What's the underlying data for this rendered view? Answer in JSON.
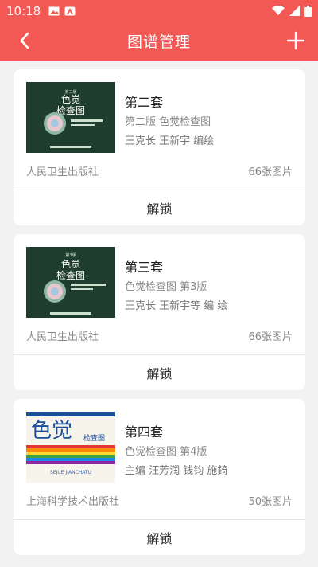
{
  "status_bar": {
    "time": "10:18"
  },
  "header": {
    "title": "图谱管理"
  },
  "books": [
    {
      "title": "第二套",
      "subtitle": "第二版 色觉检查图",
      "authors": "王克长 王新宇 编绘",
      "publisher": "人民卫生出版社",
      "count": "66张图片",
      "action": "解锁",
      "cover_text": "色觉\n检查图"
    },
    {
      "title": "第三套",
      "subtitle": "色觉检查图 第3版",
      "authors": "王克长 王新宇等 编 绘",
      "publisher": "人民卫生出版社",
      "count": "66张图片",
      "action": "解锁",
      "cover_text": "色觉\n检查图"
    },
    {
      "title": "第四套",
      "subtitle": "色觉检查图 第4版",
      "authors": "主编 汪芳润 钱钧 施錡",
      "publisher": "上海科学技术出版社",
      "count": "50张图片",
      "action": "解锁",
      "cover_text": "色觉 检查图"
    }
  ],
  "colors": {
    "accent": "#f25955",
    "cover_green": "#1f3d2e"
  },
  "icons": {
    "back": "back-chevron-icon",
    "add": "plus-icon"
  }
}
